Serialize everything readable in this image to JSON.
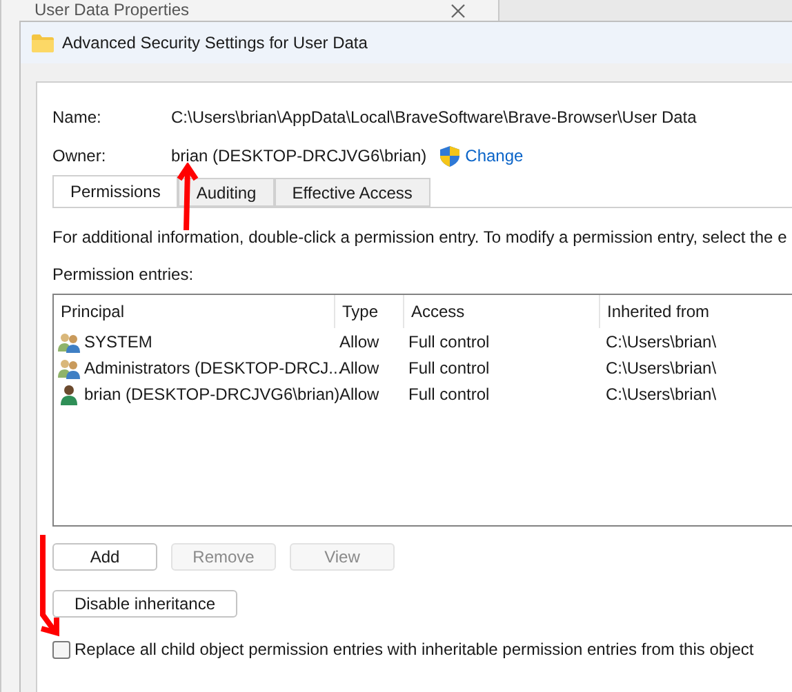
{
  "background_window": {
    "title": "User Data Properties"
  },
  "window": {
    "title": "Advanced Security Settings for User Data"
  },
  "name": {
    "label": "Name:",
    "value": "C:\\Users\\brian\\AppData\\Local\\BraveSoftware\\Brave-Browser\\User Data"
  },
  "owner": {
    "label": "Owner:",
    "value": "brian (DESKTOP-DRCJVG6\\brian)",
    "change_link": "Change"
  },
  "tabs": [
    {
      "label": "Permissions",
      "selected": true
    },
    {
      "label": "Auditing",
      "selected": false
    },
    {
      "label": "Effective Access",
      "selected": false
    }
  ],
  "info_text": "For additional information, double-click a permission entry. To modify a permission entry, select the e",
  "entries_label": "Permission entries:",
  "table": {
    "columns": [
      "Principal",
      "Type",
      "Access",
      "Inherited from"
    ],
    "rows": [
      {
        "principal": "SYSTEM",
        "kind": "group",
        "type": "Allow",
        "access": "Full control",
        "inherited_from": "C:\\Users\\brian\\"
      },
      {
        "principal": "Administrators (DESKTOP-DRCJ...",
        "kind": "group",
        "type": "Allow",
        "access": "Full control",
        "inherited_from": "C:\\Users\\brian\\"
      },
      {
        "principal": "brian (DESKTOP-DRCJVG6\\brian)",
        "kind": "user",
        "type": "Allow",
        "access": "Full control",
        "inherited_from": "C:\\Users\\brian\\"
      }
    ]
  },
  "buttons": [
    {
      "label": "Add",
      "disabled": false
    },
    {
      "label": "Remove",
      "disabled": true
    },
    {
      "label": "View",
      "disabled": true
    }
  ],
  "inheritance_button": "Disable inheritance",
  "replace_checkbox": {
    "label": "Replace all child object permission entries with inheritable permission entries from this object",
    "checked": false
  }
}
